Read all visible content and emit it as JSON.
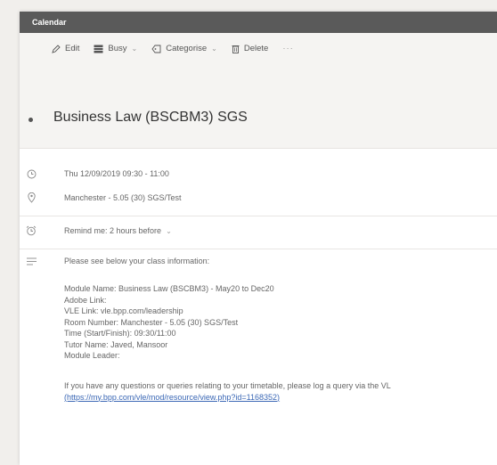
{
  "window": {
    "title": "Calendar"
  },
  "toolbar": {
    "edit_label": "Edit",
    "busy_label": "Busy",
    "categorise_label": "Categorise",
    "delete_label": "Delete",
    "more_label": "···"
  },
  "event": {
    "title": "Business Law (BSCBM3) SGS",
    "datetime": "Thu 12/09/2019 09:30 - 11:00",
    "location": "Manchester - 5.05 (30) SGS/Test",
    "reminder": "Remind me: 2 hours before"
  },
  "description": {
    "intro": "Please see below your class information:",
    "lines": [
      "Module Name: Business Law  (BSCBM3) - May20 to Dec20",
      "Adobe Link:",
      "VLE Link: vle.bpp.com/leadership",
      "Room Number: Manchester - 5.05 (30) SGS/Test",
      "Time (Start/Finish): 09:30/11:00",
      "Tutor Name: Javed, Mansoor",
      "Module Leader:"
    ],
    "footer": "If you have any questions or queries relating to your timetable, please log a query via the VL",
    "link": "(https://my.bpp.com/vle/mod/resource/view.php?id=1168352)"
  }
}
